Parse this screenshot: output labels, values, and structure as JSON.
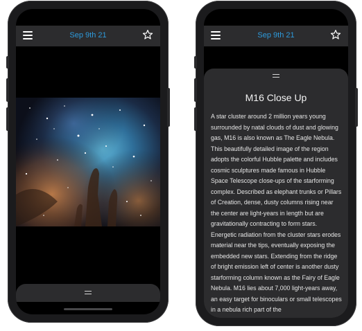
{
  "left_screen": {
    "navbar": {
      "date_label": "Sep 9th 21",
      "menu_icon": "hamburger-menu-icon",
      "favorite_icon": "star-outline-icon"
    },
    "image": {
      "subject": "M16 Close Up"
    },
    "drawer": {
      "grip_icon": "drag-grip-icon"
    }
  },
  "right_screen": {
    "navbar": {
      "date_label": "Sep 9th 21",
      "menu_icon": "hamburger-menu-icon",
      "favorite_icon": "star-outline-icon"
    },
    "sheet": {
      "grip_icon": "drag-grip-icon",
      "title": "M16 Close Up",
      "description": "A star cluster around 2 million years young surrounded by natal clouds of dust and glowing gas, M16 is also known as The Eagle Nebula. This beautifully detailed image of the region adopts the colorful Hubble palette and includes cosmic sculptures made famous in Hubble Space Telescope close-ups of the starforming complex. Described as elephant trunks or Pillars of Creation, dense, dusty columns rising near the center are light-years in length but are gravitationally contracting to form stars. Energetic radiation from the cluster stars erodes material near the tips, eventually exposing the embedded new stars. Extending from the ridge of bright emission left of center is another dusty starforming column known as the Fairy of Eagle Nebula. M16 lies about 7,000 light-years away, an easy target for binoculars or small telescopes in a nebula rich part of the"
    }
  },
  "colors": {
    "accent": "#2e9bdc",
    "bar": "#2c2c2e",
    "screen": "#000000"
  }
}
